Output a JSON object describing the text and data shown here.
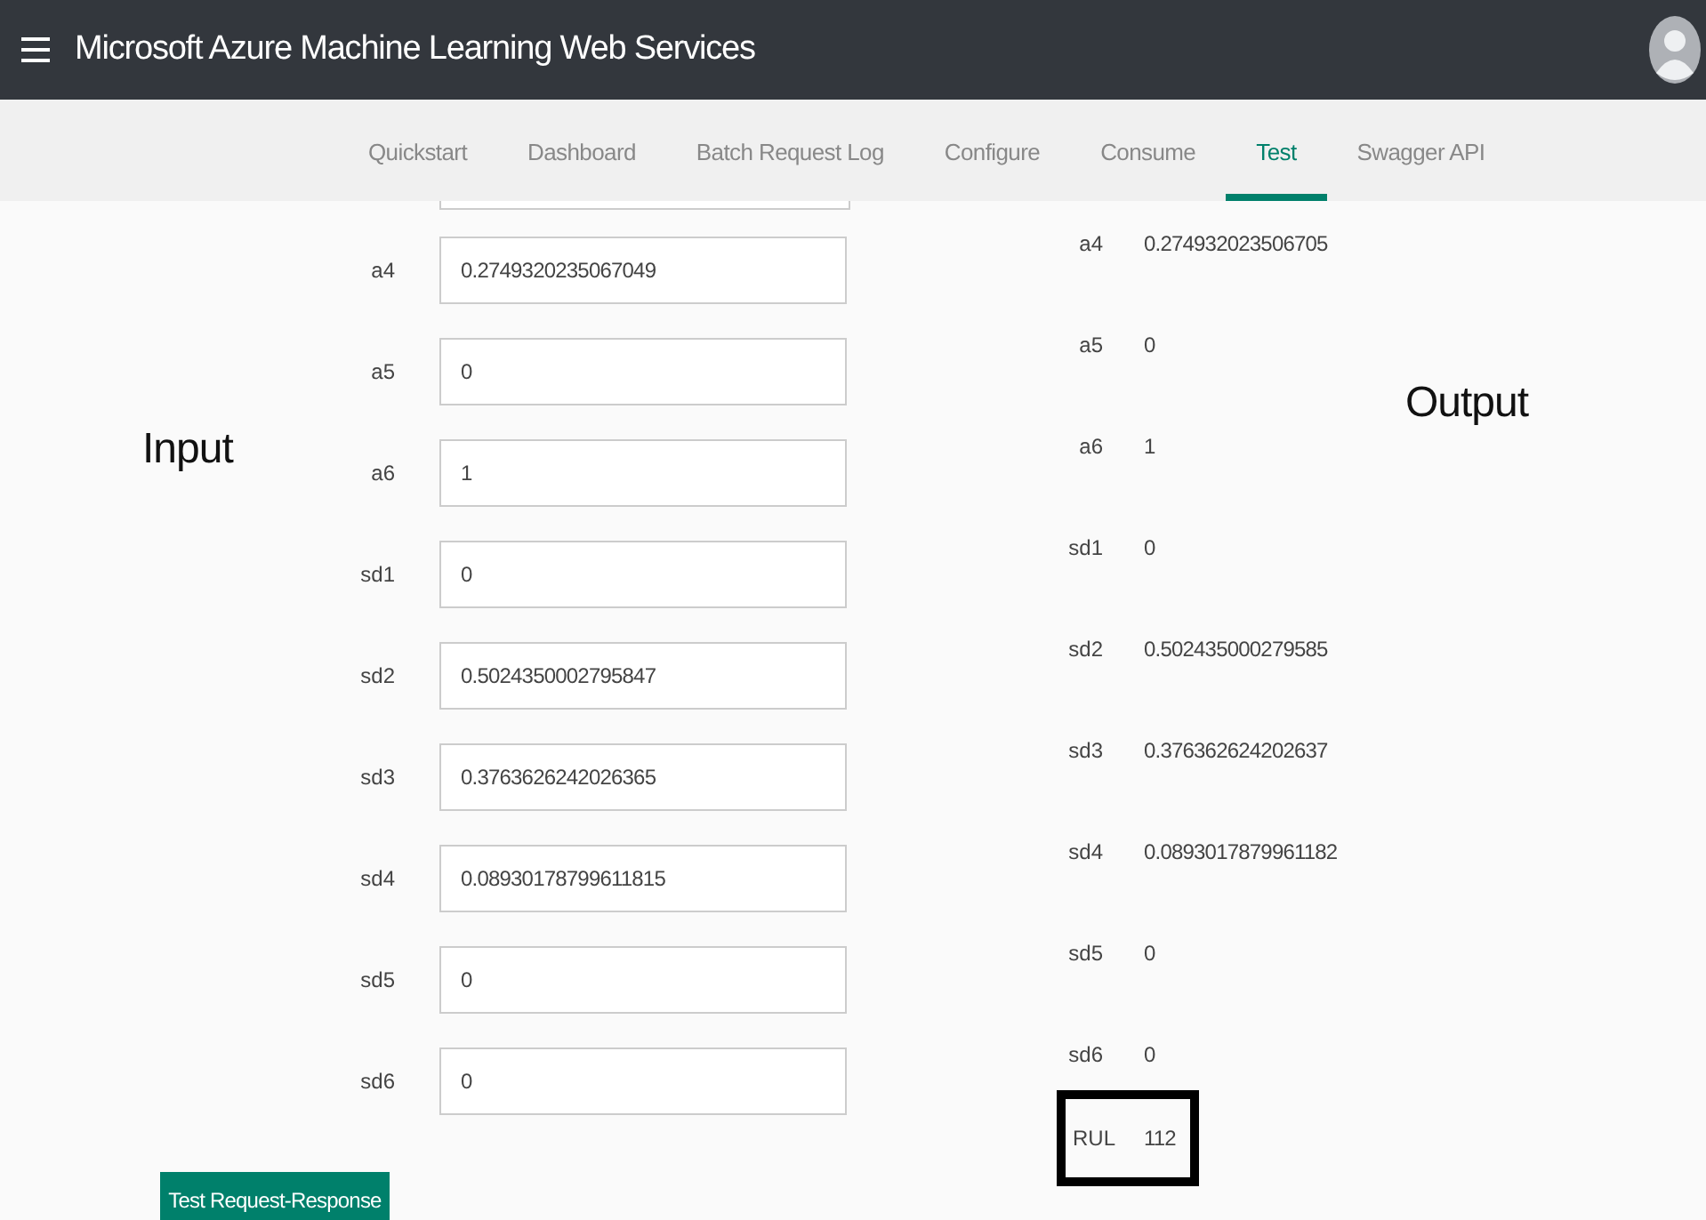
{
  "header": {
    "title": "Microsoft Azure Machine Learning Web Services"
  },
  "tabs": [
    {
      "label": "Quickstart",
      "selected": false
    },
    {
      "label": "Dashboard",
      "selected": false
    },
    {
      "label": "Batch Request Log",
      "selected": false
    },
    {
      "label": "Configure",
      "selected": false
    },
    {
      "label": "Consume",
      "selected": false
    },
    {
      "label": "Test",
      "selected": true
    },
    {
      "label": "Swagger API",
      "selected": false
    }
  ],
  "input": {
    "heading": "Input",
    "fields": [
      {
        "label": "a4",
        "value": "0.2749320235067049"
      },
      {
        "label": "a5",
        "value": "0"
      },
      {
        "label": "a6",
        "value": "1"
      },
      {
        "label": "sd1",
        "value": "0"
      },
      {
        "label": "sd2",
        "value": "0.5024350002795847"
      },
      {
        "label": "sd3",
        "value": "0.3763626242026365"
      },
      {
        "label": "sd4",
        "value": "0.08930178799611815"
      },
      {
        "label": "sd5",
        "value": "0"
      },
      {
        "label": "sd6",
        "value": "0"
      }
    ],
    "button": "Test Request-Response"
  },
  "output": {
    "heading": "Output",
    "rows": [
      {
        "label": "a4",
        "value": "0.274932023506705",
        "highlighted": false
      },
      {
        "label": "a5",
        "value": "0",
        "highlighted": false
      },
      {
        "label": "a6",
        "value": "1",
        "highlighted": false
      },
      {
        "label": "sd1",
        "value": "0",
        "highlighted": false
      },
      {
        "label": "sd2",
        "value": "0.502435000279585",
        "highlighted": false
      },
      {
        "label": "sd3",
        "value": "0.376362624202637",
        "highlighted": false
      },
      {
        "label": "sd4",
        "value": "0.0893017879961182",
        "highlighted": false
      },
      {
        "label": "sd5",
        "value": "0",
        "highlighted": false
      },
      {
        "label": "sd6",
        "value": "0",
        "highlighted": false
      },
      {
        "label": "RUL",
        "value": "112",
        "highlighted": true
      }
    ]
  }
}
